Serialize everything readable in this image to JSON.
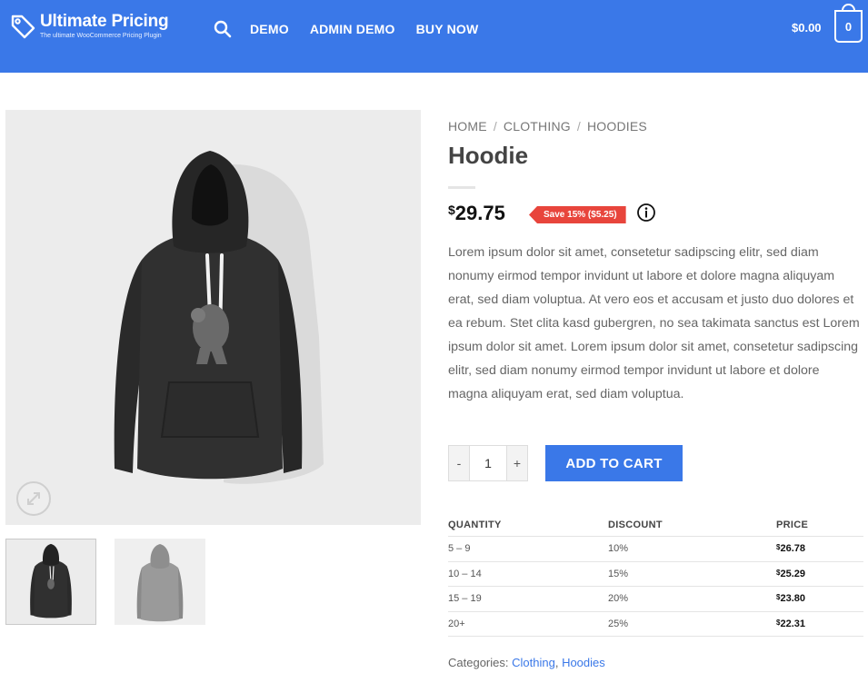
{
  "header": {
    "logo_title": "Ultimate Pricing",
    "logo_subtitle": "The ultimate WooCommerce Pricing Plugin",
    "nav": [
      "DEMO",
      "ADMIN DEMO",
      "BUY NOW"
    ],
    "cart_total": "$0.00",
    "cart_count": "0",
    "brand_color": "#3a78e8"
  },
  "breadcrumb": {
    "home": "HOME",
    "separator": "/",
    "category": "CLOTHING",
    "subcategory": "HOODIES"
  },
  "product": {
    "title": "Hoodie",
    "price_currency": "$",
    "price_value": "29.75",
    "save_badge": "Save 15% ($5.25)",
    "description": "Lorem ipsum dolor sit amet, consetetur sadipscing elitr, sed diam nonumy eirmod tempor invidunt ut labore et dolore magna aliquyam erat, sed diam voluptua. At vero eos et accusam et justo duo dolores et ea rebum. Stet clita kasd gubergren, no sea takimata sanctus est Lorem ipsum dolor sit amet. Lorem ipsum dolor sit amet, consetetur sadipscing elitr, sed diam nonumy eirmod tempor invidunt ut labore et dolore magna aliquyam erat, sed diam voluptua.",
    "qty_minus": "-",
    "qty_value": "1",
    "qty_plus": "+",
    "add_to_cart": "ADD TO CART"
  },
  "discount_table": {
    "headers": [
      "QUANTITY",
      "DISCOUNT",
      "PRICE"
    ],
    "rows": [
      {
        "quantity": "5 – 9",
        "discount": "10%",
        "currency": "$",
        "price": "26.78"
      },
      {
        "quantity": "10 – 14",
        "discount": "15%",
        "currency": "$",
        "price": "25.29"
      },
      {
        "quantity": "15 – 19",
        "discount": "20%",
        "currency": "$",
        "price": "23.80"
      },
      {
        "quantity": "20+",
        "discount": "25%",
        "currency": "$",
        "price": "22.31"
      }
    ]
  },
  "meta": {
    "categories_label": "Categories:",
    "category_1": "Clothing",
    "category_sep": ",",
    "category_2": "Hoodies"
  },
  "icons": {
    "logo": "price-tag-icon",
    "search": "search-icon",
    "cart": "shopping-bag-icon",
    "info": "info-icon",
    "zoom": "expand-icon"
  }
}
